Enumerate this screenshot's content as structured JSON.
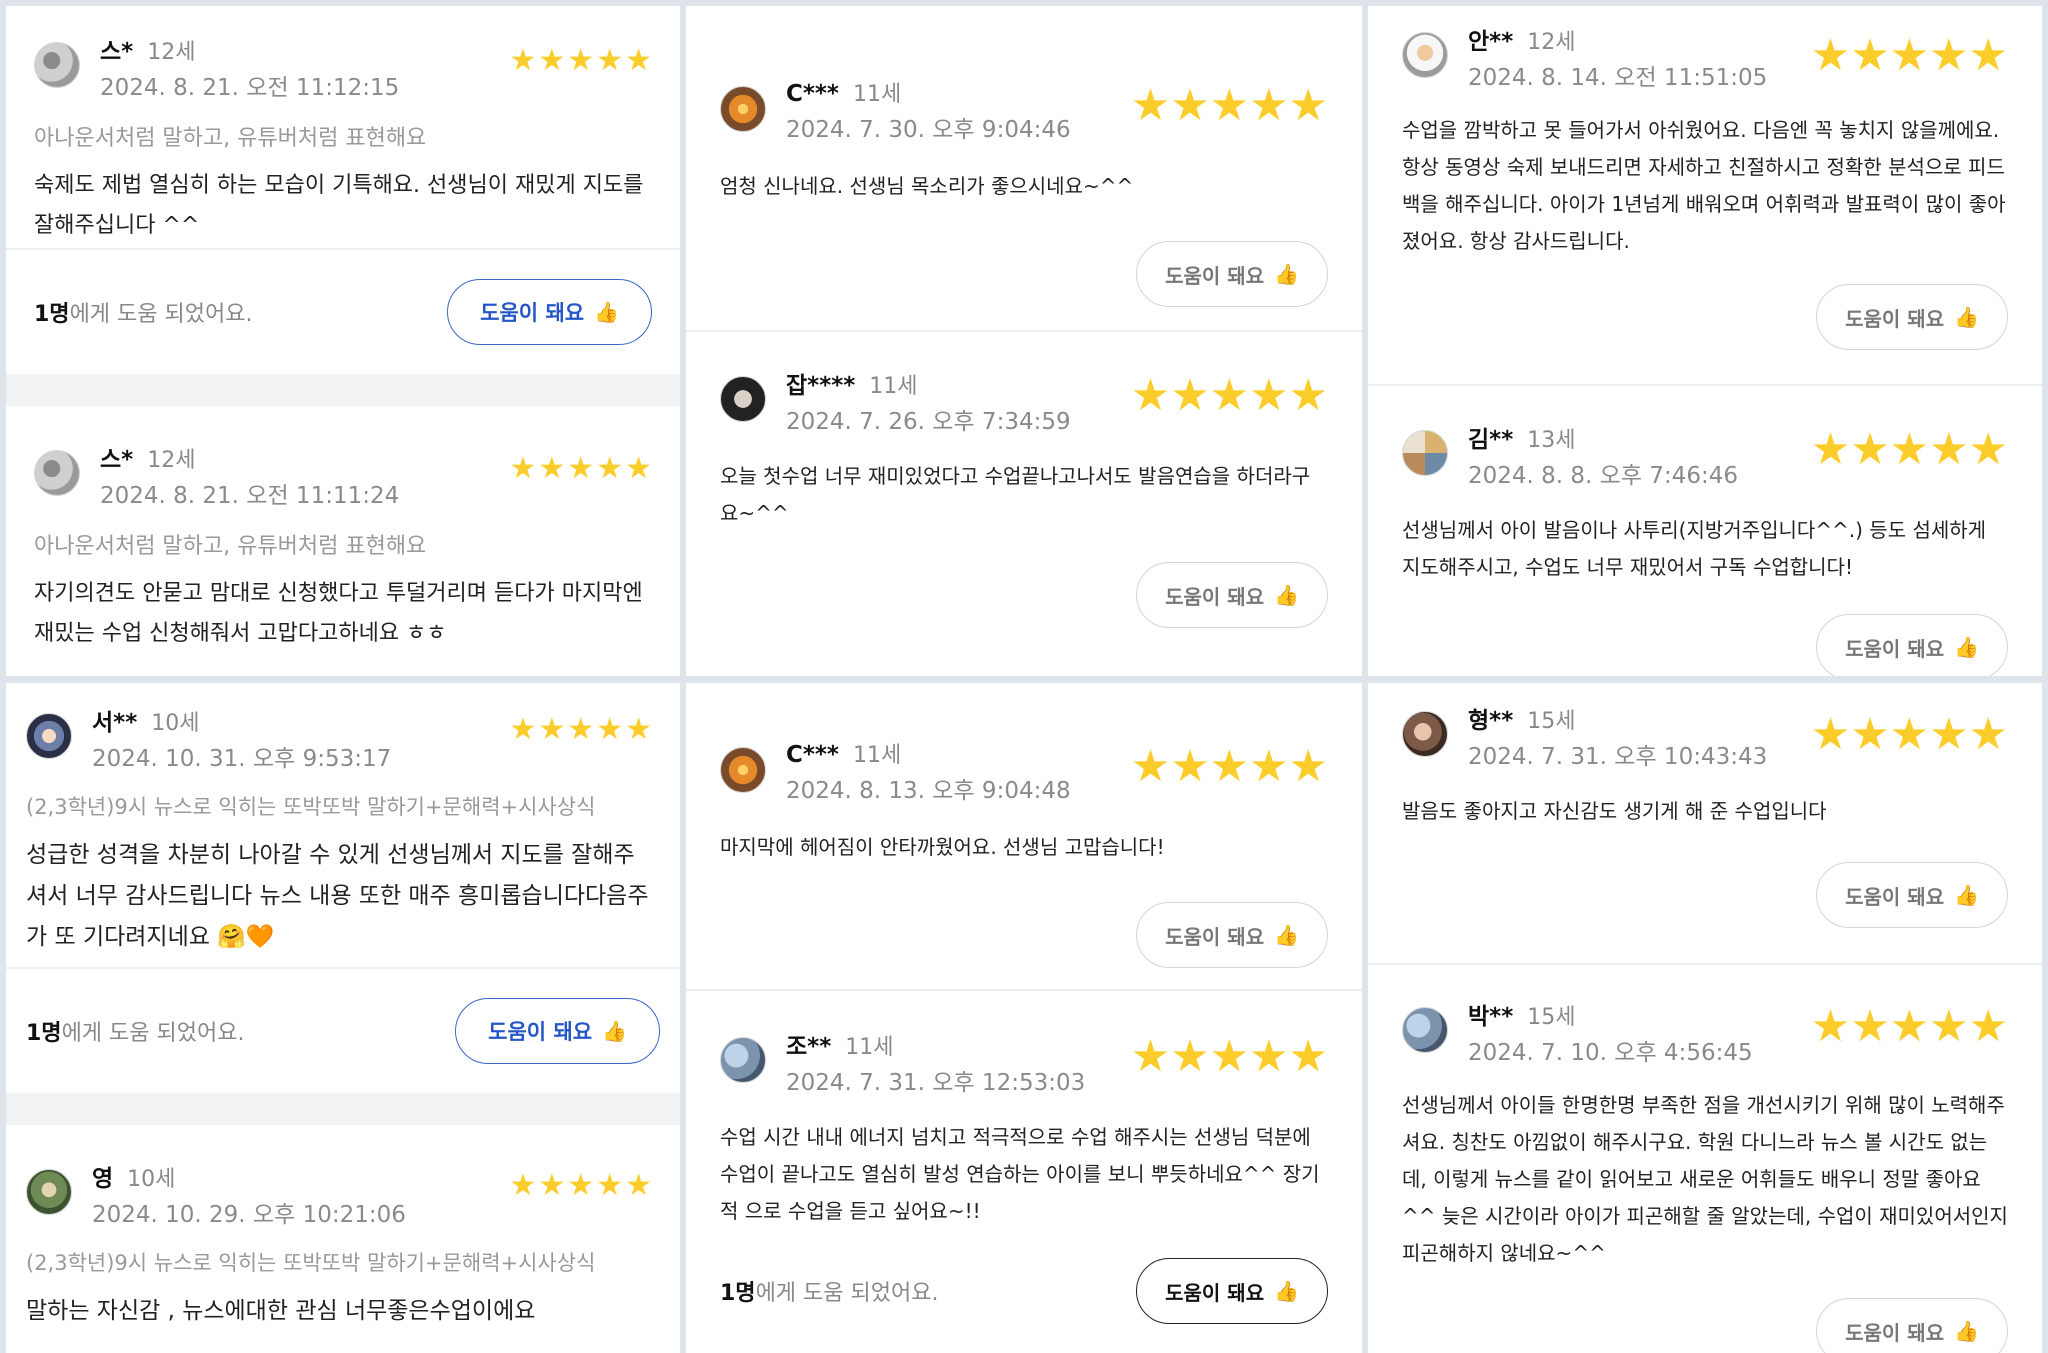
{
  "common": {
    "star": "★",
    "help_label": "도움이 돼요",
    "thumb": "👍",
    "helped_suffix": "에게 도움 되었어요."
  },
  "panels": {
    "p00": {
      "r1": {
        "name": "스*",
        "age": "12세",
        "date": "2024. 8. 21. 오전 11:12:15",
        "course": "아나운서처럼 말하고, 유튜버처럼 표현해요",
        "text": "숙제도 제법 열심히 하는 모습이 기특해요. 선생님이 재밌게 지도를 잘해주십니다 ^^",
        "helped_count": "1명"
      },
      "r2": {
        "name": "스*",
        "age": "12세",
        "date": "2024. 8. 21. 오전 11:11:24",
        "course": "아나운서처럼 말하고, 유튜버처럼 표현해요",
        "text": "자기의견도 안묻고 맘대로 신청했다고 투덜거리며 듣다가 마지막엔 재밌는 수업 신청해줘서 고맙다고하네요 ㅎㅎ"
      }
    },
    "p01": {
      "r1": {
        "name": "C***",
        "age": "11세",
        "date": "2024. 7. 30. 오후 9:04:46",
        "text": "엄청 신나네요. 선생님 목소리가 좋으시네요~^^"
      },
      "r2": {
        "name": "잡****",
        "age": "11세",
        "date": "2024. 7. 26. 오후 7:34:59",
        "text": "오늘 첫수업 너무 재미있었다고 수업끝나고나서도 발음연습을 하더라구요~^^"
      }
    },
    "p02": {
      "r1": {
        "name": "안**",
        "age": "12세",
        "date": "2024. 8. 14. 오전 11:51:05",
        "text": "수업을 깜박하고 못 들어가서 아쉬웠어요. 다음엔 꼭 놓치지 않을께에요. 항상 동영상 숙제 보내드리면 자세하고 친절하시고 정확한 분석으로 피드백을 해주십니다. 아이가 1년넘게 배워오며 어휘력과 발표력이 많이 좋아졌어요. 항상 감사드립니다."
      },
      "r2": {
        "name": "김**",
        "age": "13세",
        "date": "2024. 8. 8. 오후 7:46:46",
        "text": "선생님께서 아이 발음이나 사투리(지방거주입니다^^.) 등도 섬세하게 지도해주시고, 수업도 너무 재밌어서 구독 수업합니다!"
      }
    },
    "p10": {
      "r1": {
        "name": "서**",
        "age": "10세",
        "date": "2024. 10. 31. 오후 9:53:17",
        "course": "(2,3학년)9시 뉴스로 익히는 또박또박 말하기+문해력+시사상식",
        "text": "성급한 성격을 차분히 나아갈 수 있게 선생님께서 지도를 잘해주셔서 너무 감사드립니다 뉴스 내용 또한 매주 흥미롭습니다다음주가 또 기다려지네요 🤗🧡",
        "helped_count": "1명"
      },
      "r2": {
        "name": "영",
        "age": "10세",
        "date": "2024. 10. 29. 오후 10:21:06",
        "course": "(2,3학년)9시 뉴스로 익히는 또박또박 말하기+문해력+시사상식",
        "text": "말하는 자신감 , 뉴스에대한 관심 너무좋은수업이에요"
      }
    },
    "p11": {
      "r1": {
        "name": "C***",
        "age": "11세",
        "date": "2024. 8. 13. 오후 9:04:48",
        "text": "마지막에 헤어짐이 안타까웠어요. 선생님 고맙습니다!"
      },
      "r2": {
        "name": "조**",
        "age": "11세",
        "date": "2024. 7. 31. 오후 12:53:03",
        "text": "수업 시간 내내 에너지 넘치고 적극적으로 수업 해주시는 선생님 덕분에 수업이 끝나고도 열심히 발성 연습하는 아이를 보니 뿌듯하네요^^ 장기적 으로 수업을 듣고 싶어요~!!",
        "helped_count": "1명"
      }
    },
    "p12": {
      "r1": {
        "name": "형**",
        "age": "15세",
        "date": "2024. 7. 31. 오후 10:43:43",
        "text": "발음도 좋아지고 자신감도 생기게 해 준 수업입니다"
      },
      "r2": {
        "name": "박**",
        "age": "15세",
        "date": "2024. 7. 10. 오후 4:56:45",
        "text": "선생님께서 아이들 한명한명 부족한 점을 개선시키기 위해 많이 노력해주셔요. 칭찬도 아낌없이 해주시구요. 학원 다니느라 뉴스 볼 시간도 없는데, 이렇게 뉴스를 같이 읽어보고 새로운 어휘들도 배우니 정말 좋아요^^ 늦은 시간이라 아이가 피곤해할 줄 알았는데, 수업이 재미있어서인지 피곤해하지 않네요~^^"
      }
    }
  }
}
